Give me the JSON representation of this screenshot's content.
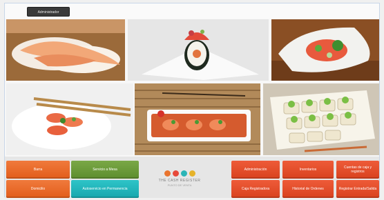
{
  "topbar": {
    "admin_label": "Administrador"
  },
  "gallery": {
    "images": [
      {
        "alt": "nigiri sushi"
      },
      {
        "alt": "sushi roll"
      },
      {
        "alt": "salmon salad"
      },
      {
        "alt": "salmon slices"
      },
      {
        "alt": "sashimi platter"
      },
      {
        "alt": "maki rolls"
      }
    ]
  },
  "buttons": {
    "bar": "Barra",
    "mesas": "Servicio a Mesa",
    "domicilio": "Domicilio",
    "autoservicio": "Autoservicio en Permanencia",
    "administracion": "Administración",
    "inventarios": "Inventarios",
    "cuentas": "Cuentas de caja y registros",
    "caja": "Caja Registradora",
    "historial": "Historial de Ordenes",
    "registro": "Registrar Entrada/Salida"
  },
  "logo": {
    "name": "THE CASH REGISTER",
    "sub": "PUNTO DE VENTA"
  },
  "colors": {
    "orange": "#e8692b",
    "red": "#e24d2a",
    "green": "#6a9a3a",
    "teal": "#23b6bb",
    "logo_marks": [
      "#e9742e",
      "#e74a3b",
      "#2bb5b7",
      "#e6b32a"
    ]
  }
}
